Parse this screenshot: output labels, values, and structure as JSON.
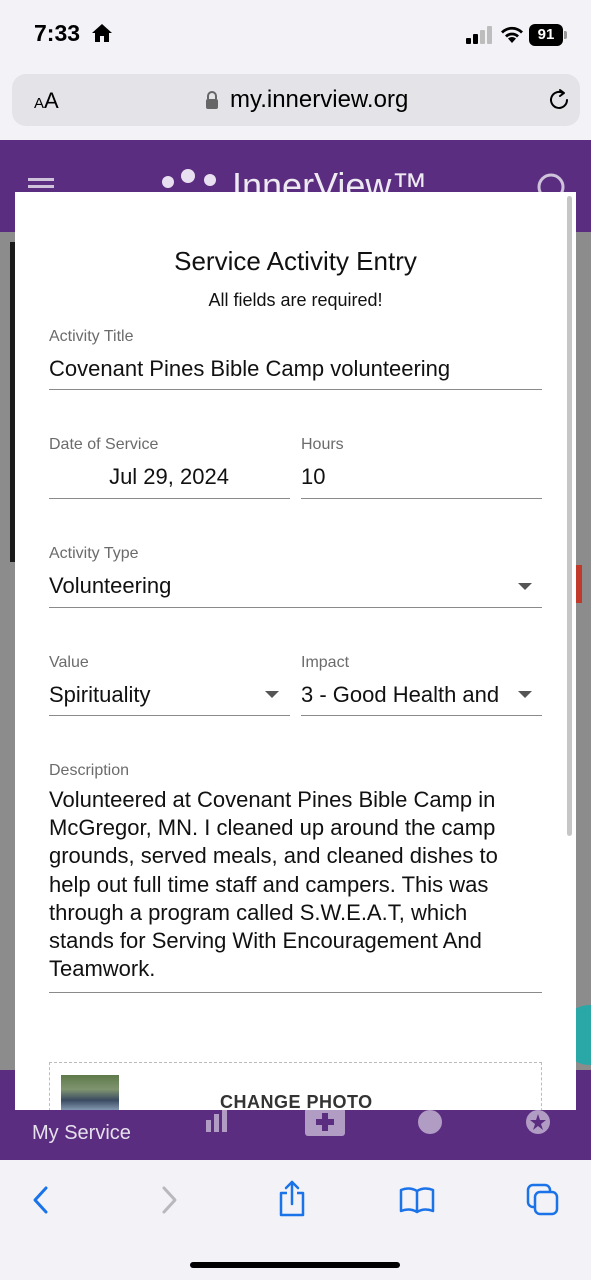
{
  "status_bar": {
    "time": "7:33",
    "battery": "91"
  },
  "browser": {
    "aa_label_small": "A",
    "aa_label_large": "A",
    "url": "my.innerview.org"
  },
  "app": {
    "logo_text": "InnerView™",
    "nav_label": "My Service"
  },
  "form": {
    "title": "Service Activity Entry",
    "subtitle": "All fields are required!",
    "activity_title": {
      "label": "Activity Title",
      "value": "Covenant Pines Bible Camp volunteering"
    },
    "date_of_service": {
      "label": "Date of Service",
      "value": "Jul 29, 2024"
    },
    "hours": {
      "label": "Hours",
      "value": "10"
    },
    "activity_type": {
      "label": "Activity Type",
      "value": "Volunteering"
    },
    "value": {
      "label": "Value",
      "value": "Spirituality"
    },
    "impact": {
      "label": "Impact",
      "value": "3 - Good Health and"
    },
    "description": {
      "label": "Description",
      "value": "Volunteered at Covenant Pines Bible Camp in McGregor, MN. I cleaned up around the camp grounds, served meals, and cleaned dishes to help out full time staff and campers. This was through a program called S.W.E.A.T, which stands for Serving With Encouragement And Teamwork."
    },
    "change_photo_label": "CHANGE PHOTO"
  },
  "colors": {
    "brand_purple": "#5b2d80",
    "ios_blue": "#1a73e8",
    "accent_teal": "#2aa8a8"
  }
}
